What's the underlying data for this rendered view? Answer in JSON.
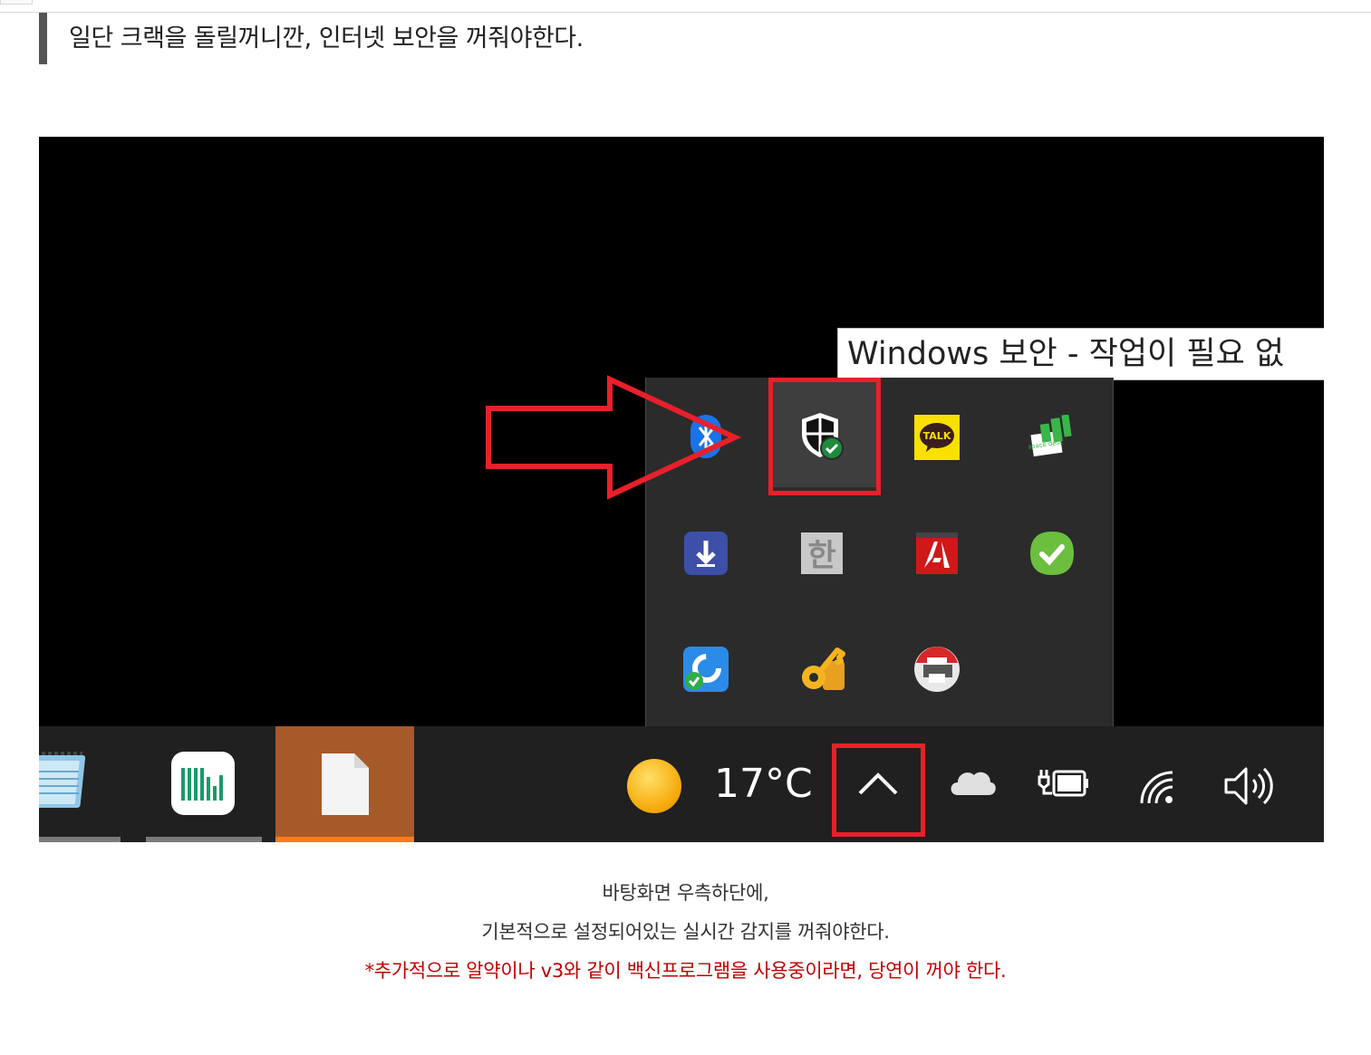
{
  "blockquote": {
    "text": "일단 크랙을 돌릴꺼니깐, 인터넷 보안을 꺼줘야한다."
  },
  "screenshot": {
    "tooltip": "Windows 보안 - 작업이 필요 없",
    "tray_icons": [
      [
        "bluetooth-icon",
        "windows-security-icon",
        "kakaotalk-icon",
        "spacedesk-icon"
      ],
      [
        "download-icon",
        "hangul-ime-icon",
        "adobe-icon",
        "green-check-icon"
      ],
      [
        "sync-icon",
        "keys-icon",
        "printer-icon"
      ]
    ],
    "kakaotalk_label": "TALK",
    "hangul_char": "한",
    "spacedesk_label": "space desk",
    "temperature": "17°C",
    "accent_red": "#e8202a"
  },
  "captions": {
    "line1": "바탕화면 우측하단에,",
    "line2": "기본적으로 설정되어있는 실시간 감지를 꺼줘야한다.",
    "line3": "*추가적으로 알약이나 v3와 같이 백신프로그램을 사용중이라면, 당연이 꺼야 한다."
  }
}
